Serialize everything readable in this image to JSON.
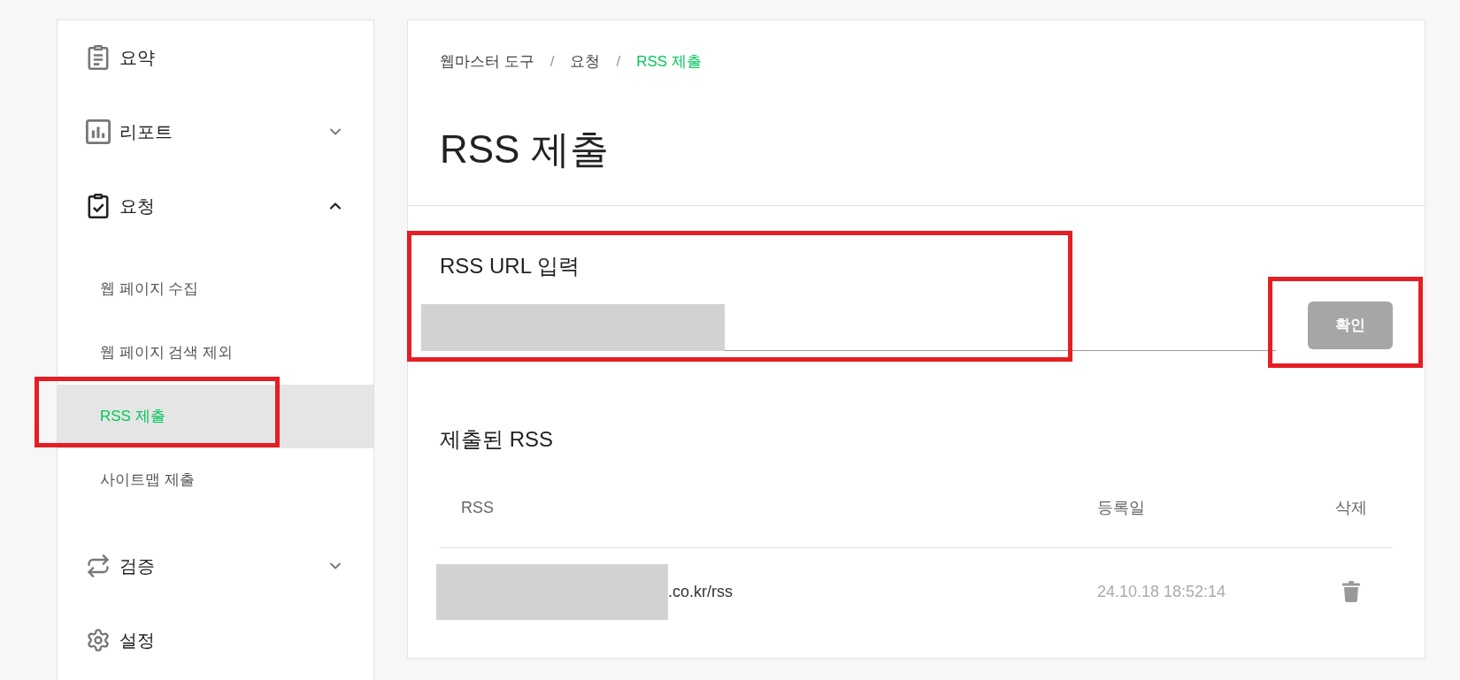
{
  "sidebar": {
    "items": [
      {
        "kind": "link",
        "label": "요약"
      },
      {
        "kind": "group",
        "label": "리포트",
        "expanded": false
      },
      {
        "kind": "group",
        "label": "요청",
        "expanded": true,
        "children": [
          {
            "label": "웹 페이지 수집",
            "selected": false,
            "highlighted": false
          },
          {
            "label": "웹 페이지 검색 제외",
            "selected": false,
            "highlighted": false
          },
          {
            "label": "RSS 제출",
            "selected": true,
            "highlighted": true
          },
          {
            "label": "사이트맵 제출",
            "selected": false,
            "highlighted": false
          }
        ]
      },
      {
        "kind": "group",
        "label": "검증",
        "expanded": false
      },
      {
        "kind": "link",
        "label": "설정"
      }
    ]
  },
  "breadcrumb": [
    {
      "kind": "link",
      "label": "웹마스터 도구",
      "current": false
    },
    {
      "kind": "separator",
      "label": "/"
    },
    {
      "kind": "link",
      "label": "요청",
      "current": false
    },
    {
      "kind": "separator",
      "label": "/"
    },
    {
      "kind": "link",
      "label": "RSS 제출",
      "current": true
    }
  ],
  "page_title": "RSS 제출",
  "url_form": {
    "label": "RSS URL 입력",
    "value_redacted": true,
    "highlighted": true,
    "submit_button": {
      "label": "확인",
      "disabled": true,
      "highlighted": true
    }
  },
  "submitted": {
    "title": "제출된 RSS",
    "columns": [
      "RSS",
      "등록일",
      "삭제"
    ],
    "rows": [
      {
        "rss": ".co.kr/rss",
        "rss_redacted": true,
        "registered": "24.10.18 18:52:14"
      }
    ]
  }
}
